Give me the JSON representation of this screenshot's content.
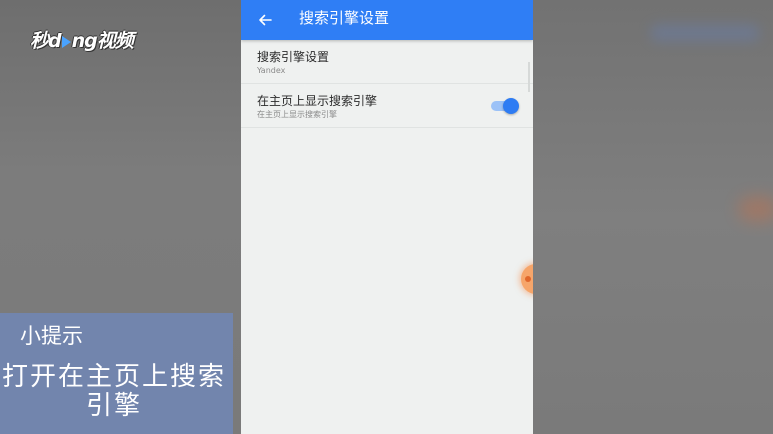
{
  "watermark": {
    "text_before": "秒d",
    "text_after": "ng视频"
  },
  "settings_screen": {
    "title": "搜索引擎设置",
    "back_icon": "arrow-left-icon",
    "accent_color": "#2f7ef5",
    "items": [
      {
        "title": "搜索引擎设置",
        "subtitle": "Yandex"
      },
      {
        "title": "在主页上显示搜索引擎",
        "subtitle": "在主页上显示搜索引擎",
        "toggle_on": true
      }
    ]
  },
  "tip": {
    "title": "小提示",
    "body": "打开在主页上搜索引擎"
  }
}
